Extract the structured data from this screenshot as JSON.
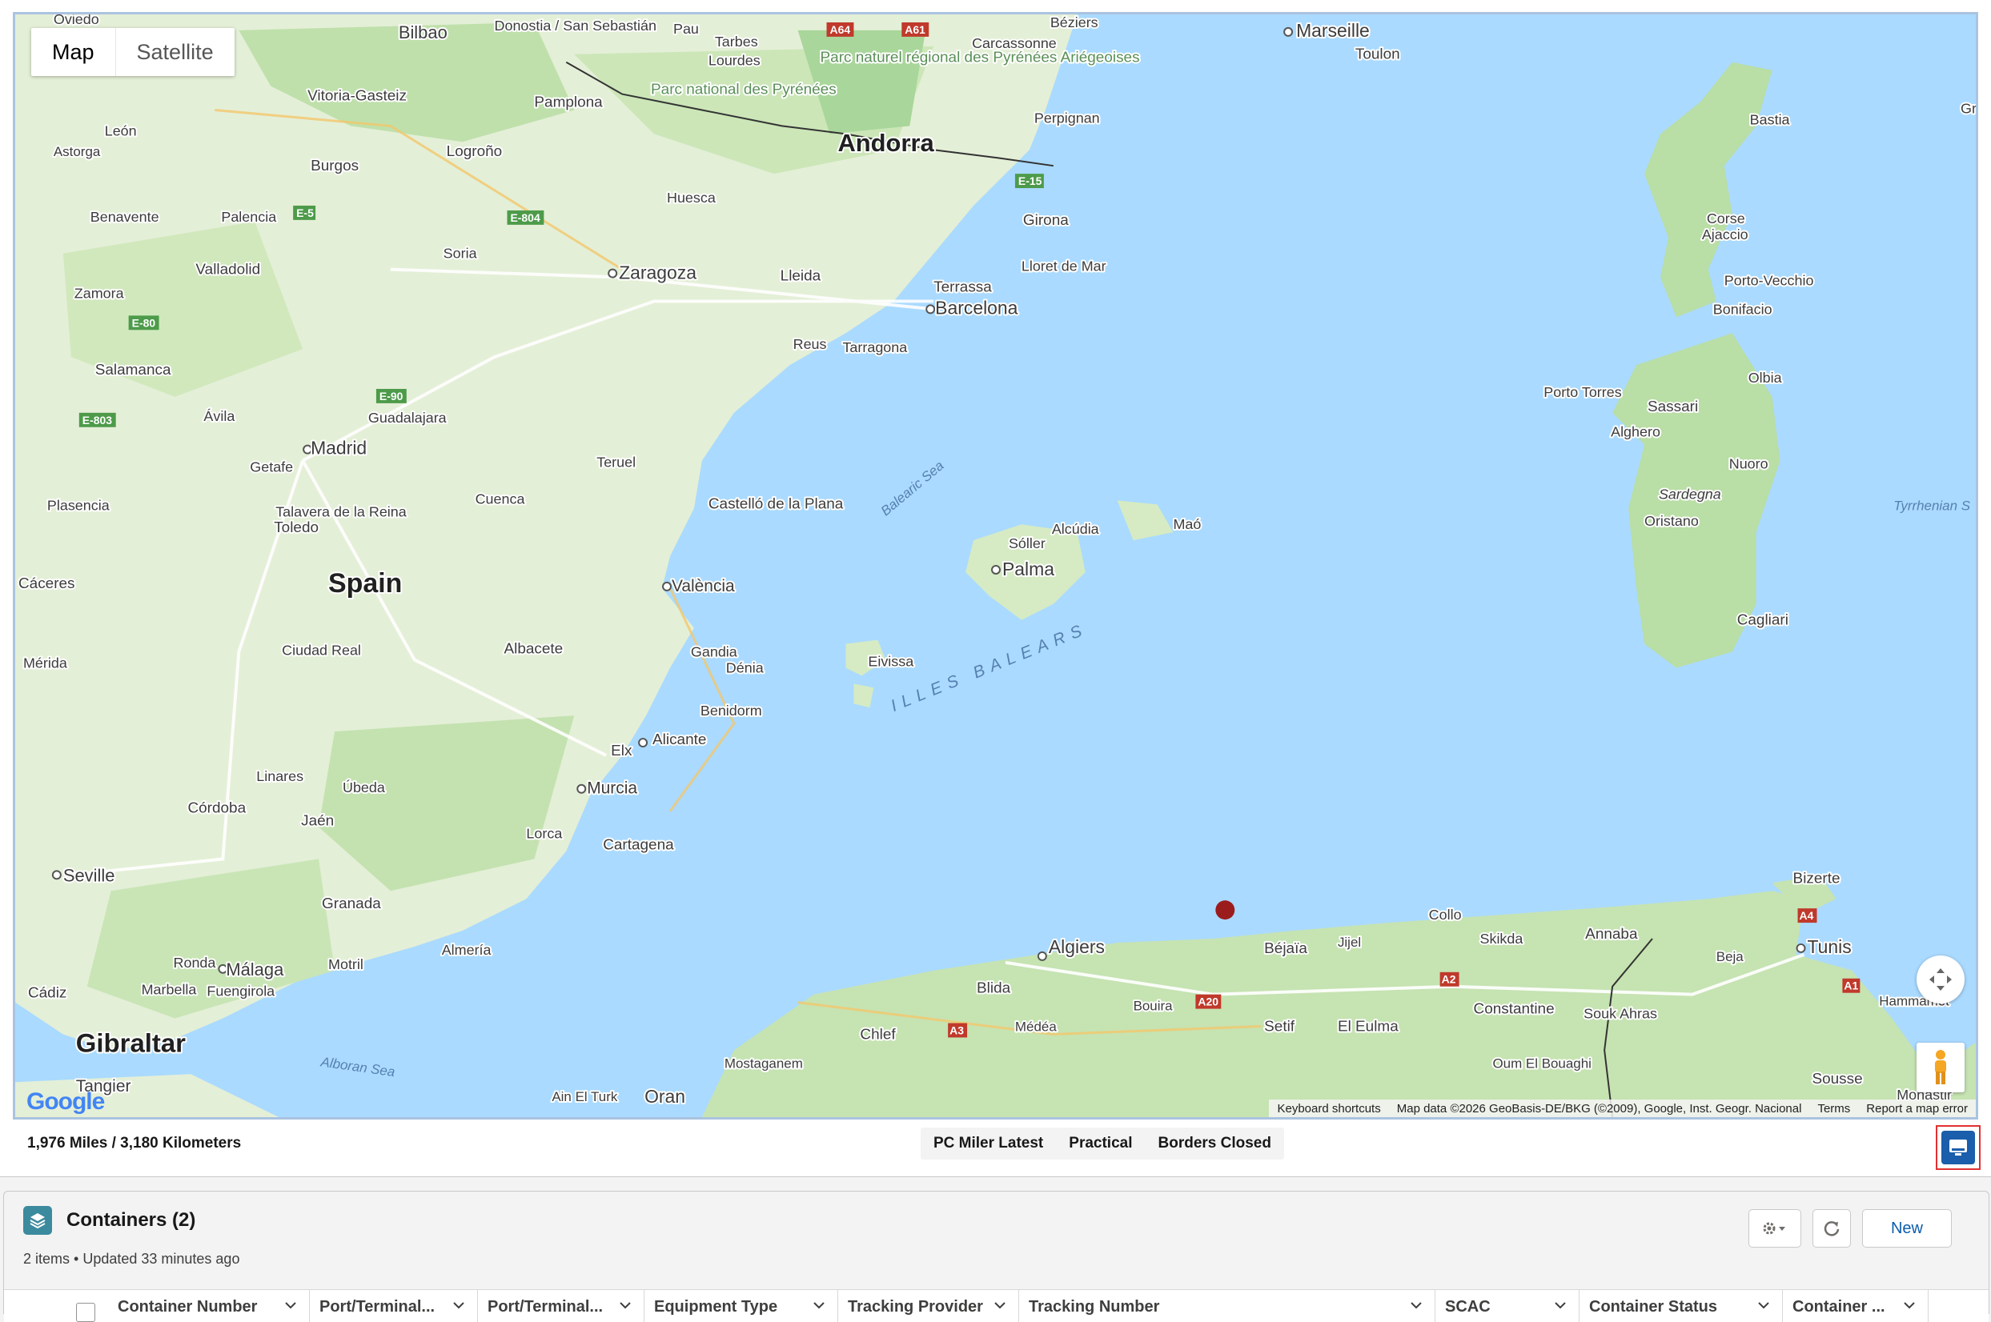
{
  "map": {
    "type_buttons": [
      "Map",
      "Satellite"
    ],
    "active_type": "Map",
    "attribution": [
      "Keyboard shortcuts",
      "Map data ©2026 GeoBasis-DE/BKG (©2009), Google, Inst. Geogr. Nacional",
      "Terms",
      "Report a map error"
    ],
    "logo": "Google",
    "countries": [
      "Spain",
      "Andorra",
      "Gibraltar"
    ],
    "sea_labels": [
      "Balearic Sea",
      "Alboran Sea",
      "Tyrrhenian S",
      "ILLES BALEARS"
    ],
    "cities": [
      "Oviedo",
      "Bilbao",
      "Donostia / San Sebastián",
      "Pau",
      "Tarbes",
      "Lourdes",
      "Béziers",
      "Marseille",
      "Toulon",
      "Carcassonne",
      "Parc naturel régional des Pyrénées Ariégeoises",
      "Parc national des Pyrénées",
      "Vitoria-Gasteiz",
      "Pamplona",
      "Perpignan",
      "Bastia",
      "Grosse",
      "León",
      "Astorga",
      "Burgos",
      "Logroño",
      "Huesca",
      "Girona",
      "Benavente",
      "Palencia",
      "Soria",
      "Zaragoza",
      "Lleida",
      "Lloret de Mar",
      "Corse",
      "Ajaccio",
      "Valladolid",
      "Zamora",
      "Terrassa",
      "Barcelona",
      "Porto-Vecchio",
      "Bonifacio",
      "Reus",
      "Tarragona",
      "Salamanca",
      "Guadalajara",
      "Ávila",
      "Madrid",
      "Getafe",
      "Teruel",
      "Porto Torres",
      "Sassari",
      "Olbia",
      "Alghero",
      "Nuoro",
      "Sardegna",
      "Oristano",
      "Cagliari",
      "Plasencia",
      "Talavera de la Reina",
      "Toledo",
      "Cuenca",
      "Castelló de la Plana",
      "Alcúdia",
      "Sóller",
      "Maó",
      "Palma",
      "Cáceres",
      "València",
      "Mérida",
      "Ciudad Real",
      "Albacete",
      "Gandia",
      "Dénia",
      "Eivissa",
      "Benidorm",
      "Alicante",
      "Elx",
      "Linares",
      "Úbeda",
      "Córdoba",
      "Murcia",
      "Jaén",
      "Lorca",
      "Cartagena",
      "Seville",
      "Granada",
      "Almería",
      "Ronda",
      "Málaga",
      "Motril",
      "Marbella",
      "Fuengirola",
      "Cádiz",
      "Tangier",
      "Oran",
      "Ain El Turk",
      "Mostaganem",
      "Chlef",
      "Médéa",
      "Blida",
      "Algiers",
      "Bouira",
      "Béjaïa",
      "Jijel",
      "Setif",
      "El Eulma",
      "Collo",
      "Skikda",
      "Annaba",
      "Constantine",
      "Oum El Bouaghi",
      "Souk Ahras",
      "Bizerte",
      "Tunis",
      "Beja",
      "Hammamet",
      "Sousse",
      "Monastir"
    ],
    "road_shields": [
      "E-5",
      "E-80",
      "E-90",
      "E-803",
      "E-804",
      "E-15",
      "A64",
      "A61",
      "A3",
      "A1",
      "A2",
      "A4",
      "A20"
    ]
  },
  "route": {
    "distance": "1,976 Miles / 3,180 Kilometers",
    "tags": [
      "PC Miler Latest",
      "Practical",
      "Borders Closed"
    ]
  },
  "containers": {
    "title": "Containers (2)",
    "meta": "2 items • Updated 33 minutes ago",
    "new_label": "New",
    "columns": [
      "Container Number",
      "Port/Terminal...",
      "Port/Terminal...",
      "Equipment Type",
      "Tracking Provider",
      "Tracking Number",
      "SCAC",
      "Container Status",
      "Container ..."
    ]
  },
  "colors": {
    "water": "#aadaff",
    "land": "#e9f1de",
    "park": "#a9d69a",
    "marker": "#9b1c1c",
    "brand": "#0b5cab",
    "highlight_border": "#e03131"
  }
}
